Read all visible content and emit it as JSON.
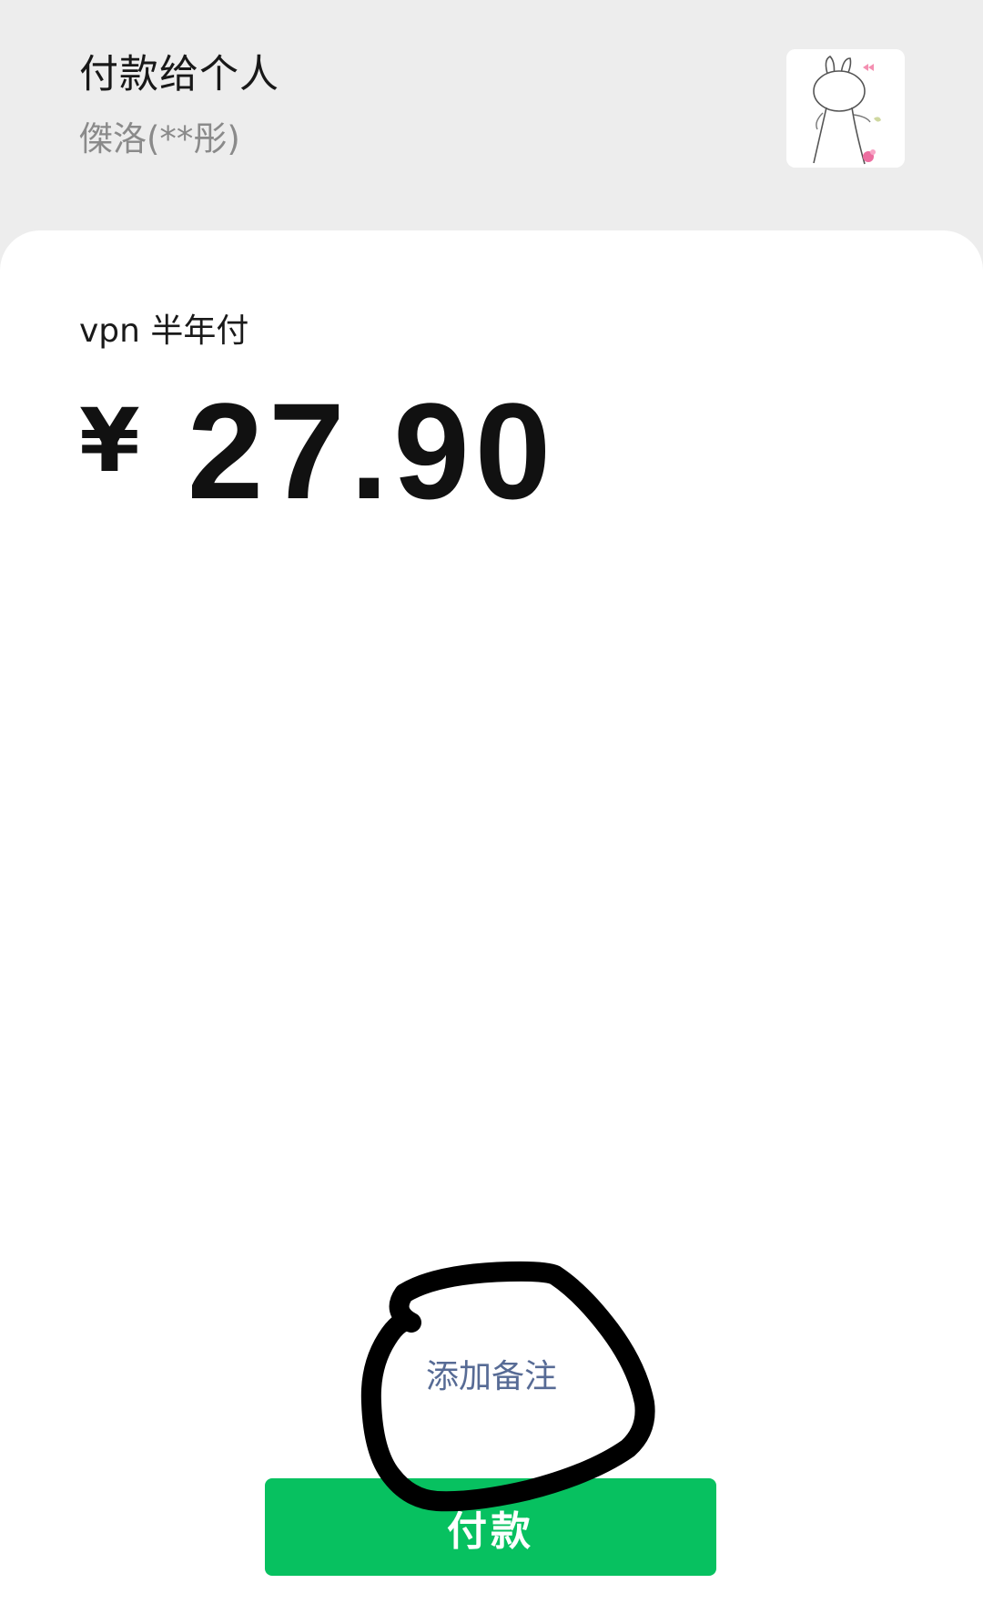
{
  "header": {
    "title": "付款给个人",
    "recipient": "傑洛(**彤)"
  },
  "payment": {
    "note": "vpn 半年付",
    "currency_symbol": "¥",
    "amount": "27.90",
    "add_note_label": "添加备注",
    "pay_button_label": "付款"
  },
  "colors": {
    "accent_green": "#07c160",
    "link_blue": "#576b95",
    "header_bg": "#ededed"
  }
}
